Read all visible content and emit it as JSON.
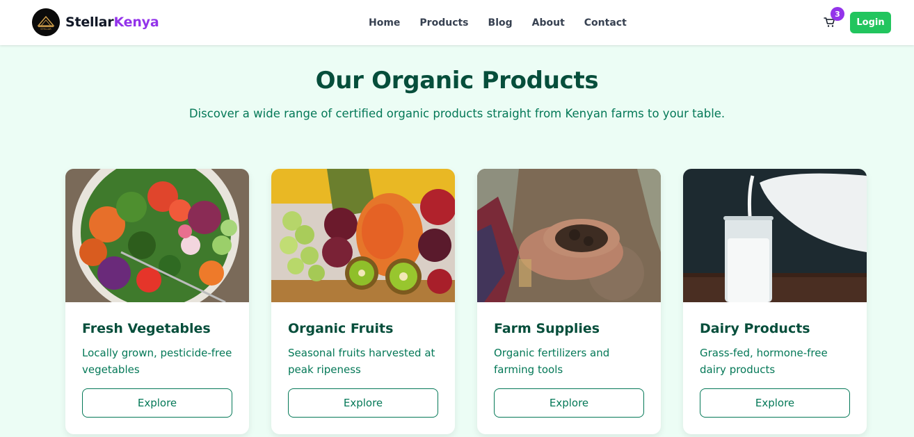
{
  "brand": {
    "name_part1": "Stellar",
    "name_part2": "Kenya",
    "logo_text": "STELLAR"
  },
  "nav": {
    "links": [
      "Home",
      "Products",
      "Blog",
      "About",
      "Contact"
    ],
    "cart_count": "3",
    "login_label": "Login"
  },
  "hero": {
    "title": "Our Organic Products",
    "subtitle": "Discover a wide range of certified organic products straight from Kenyan farms to your table."
  },
  "products": [
    {
      "title": "Fresh Vegetables",
      "description": "Locally grown, pesticide-free vegetables",
      "button": "Explore",
      "image": "vegetable-salad-photo"
    },
    {
      "title": "Organic Fruits",
      "description": "Seasonal fruits harvested at peak ripeness",
      "button": "Explore",
      "image": "fruit-basket-photo"
    },
    {
      "title": "Farm Supplies",
      "description": "Organic fertilizers and farming tools",
      "button": "Explore",
      "image": "soil-in-hands-photo"
    },
    {
      "title": "Dairy Products",
      "description": "Grass-fed, hormone-free dairy products",
      "button": "Explore",
      "image": "milk-pouring-photo"
    }
  ],
  "colors": {
    "accent_green": "#22c55e",
    "accent_purple": "#9333ea",
    "dark_green": "#064e3b",
    "text_green": "#047857",
    "page_bg": "#ecfdf5"
  }
}
